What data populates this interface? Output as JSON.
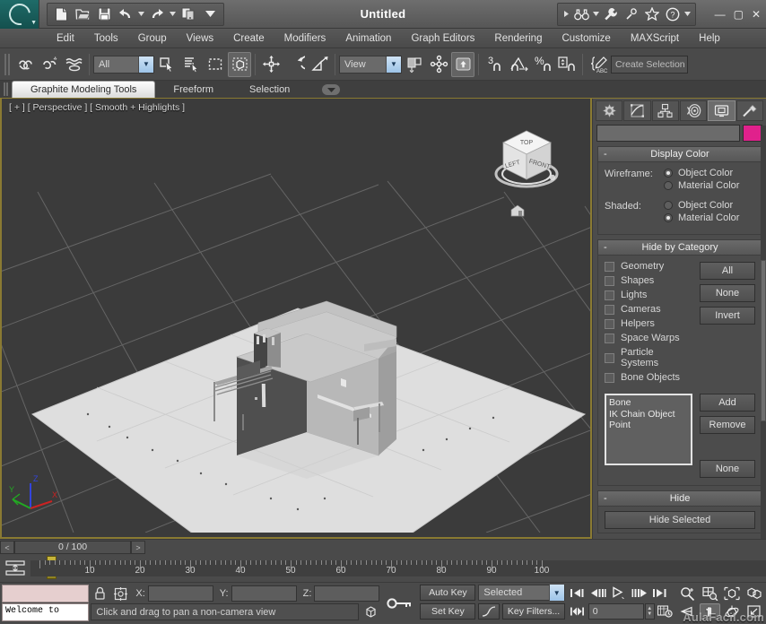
{
  "window": {
    "title": "Untitled",
    "minimize_label": "—",
    "maximize_label": "▢",
    "close_label": "✕"
  },
  "quick_access": [
    {
      "name": "new-file-icon",
      "label": "New"
    },
    {
      "name": "open-file-icon",
      "label": "Open"
    },
    {
      "name": "save-file-icon",
      "label": "Save"
    },
    {
      "name": "undo-icon",
      "label": "Undo"
    },
    {
      "name": "undo-dropdown-icon",
      "label": "Undo list"
    },
    {
      "name": "redo-icon",
      "label": "Redo"
    },
    {
      "name": "redo-dropdown-icon",
      "label": "Redo list"
    },
    {
      "name": "project-folder-icon",
      "label": "Set Project Folder"
    },
    {
      "name": "qat-dropdown-icon",
      "label": "Customize Quick Access Toolbar"
    }
  ],
  "right_quick_access": [
    {
      "name": "qat-expand-icon",
      "label": "Expand"
    },
    {
      "name": "search-binoculars-icon",
      "label": "Search"
    },
    {
      "name": "search-dropdown-icon",
      "label": "Search options"
    },
    {
      "name": "wrench-icon",
      "label": "Tools"
    },
    {
      "name": "autodesk-tool-icon",
      "label": "Autodesk Account"
    },
    {
      "name": "star-favorites-icon",
      "label": "Favorites"
    },
    {
      "name": "help-icon",
      "label": "Help"
    },
    {
      "name": "help-dropdown-icon",
      "label": "Help options"
    }
  ],
  "menu": [
    "Edit",
    "Tools",
    "Group",
    "Views",
    "Create",
    "Modifiers",
    "Animation",
    "Graph Editors",
    "Rendering",
    "Customize",
    "MAXScript",
    "Help"
  ],
  "toolbar": {
    "selection_filter": "All",
    "reference_coord": "View",
    "selection_set_placeholder": "Create Selection S",
    "buttons": [
      {
        "name": "select-and-link-icon",
        "label": "Select and Link"
      },
      {
        "name": "unlink-selection-icon",
        "label": "Unlink Selection"
      },
      {
        "name": "bind-space-warp-icon",
        "label": "Bind to Space Warp"
      },
      {
        "name": "select-object-icon",
        "label": "Select Object"
      },
      {
        "name": "select-by-name-icon",
        "label": "Select by Name"
      },
      {
        "name": "rectangular-region-icon",
        "label": "Rectangular Selection Region"
      },
      {
        "name": "window-crossing-icon",
        "label": "Window/Crossing"
      },
      {
        "name": "select-and-move-icon",
        "label": "Select and Move"
      },
      {
        "name": "select-and-rotate-icon",
        "label": "Select and Rotate"
      },
      {
        "name": "select-and-scale-icon",
        "label": "Select and Uniform Scale"
      },
      {
        "name": "use-center-icon",
        "label": "Use Pivot Point Center"
      },
      {
        "name": "select-and-manipulate-icon",
        "label": "Select and Manipulate"
      },
      {
        "name": "snaps-toggle-icon",
        "label": "3D Snaps Toggle"
      },
      {
        "name": "angle-snap-icon",
        "label": "Angle Snap Toggle"
      },
      {
        "name": "percent-snap-icon",
        "label": "Percent Snap Toggle"
      },
      {
        "name": "spinner-snap-icon",
        "label": "Spinner Snap Toggle"
      },
      {
        "name": "named-selection-sets-icon",
        "label": "Edit Named Selection Sets"
      }
    ]
  },
  "ribbon": {
    "tabs": [
      {
        "label": "Graphite Modeling Tools",
        "active": true
      },
      {
        "label": "Freeform",
        "active": false
      },
      {
        "label": "Selection",
        "active": false
      }
    ],
    "dropdown_label": "▾"
  },
  "viewport": {
    "label": "[ + ] [ Perspective ] [ Smooth + Highlights ]",
    "background": "#3b3b3b",
    "grid_color": "#6e6e6e",
    "ground_color": "#dcdcdc",
    "viewcube": {
      "top_label": "TOP",
      "left_label": "LEFT",
      "front_label": "FRONT"
    },
    "axis": {
      "x_label": "X",
      "y_label": "Y",
      "z_label": "Z",
      "x_color": "#cc2222",
      "y_color": "#22aa22",
      "z_color": "#3344dd"
    }
  },
  "command_panel": {
    "tabs": [
      {
        "name": "create-tab",
        "label": "Create",
        "active": false
      },
      {
        "name": "modify-tab",
        "label": "Modify",
        "active": false
      },
      {
        "name": "hierarchy-tab",
        "label": "Hierarchy",
        "active": false
      },
      {
        "name": "motion-tab",
        "label": "Motion",
        "active": false
      },
      {
        "name": "display-tab",
        "label": "Display",
        "active": true
      },
      {
        "name": "utilities-tab",
        "label": "Utilities",
        "active": false
      }
    ],
    "object_name": "",
    "object_color": "#e0218c",
    "display_color": {
      "title": "Display Color",
      "collapse": "-",
      "wireframe_label": "Wireframe:",
      "shaded_label": "Shaded:",
      "wireframe_options": [
        {
          "label": "Object Color",
          "selected": true
        },
        {
          "label": "Material Color",
          "selected": false
        }
      ],
      "shaded_options": [
        {
          "label": "Object Color",
          "selected": false
        },
        {
          "label": "Material Color",
          "selected": true
        }
      ]
    },
    "hide_by_category": {
      "title": "Hide by Category",
      "collapse": "-",
      "categories": [
        {
          "label": "Geometry",
          "checked": false
        },
        {
          "label": "Shapes",
          "checked": false
        },
        {
          "label": "Lights",
          "checked": false
        },
        {
          "label": "Cameras",
          "checked": false
        },
        {
          "label": "Helpers",
          "checked": false
        },
        {
          "label": "Space Warps",
          "checked": false
        },
        {
          "label": "Particle Systems",
          "checked": false
        },
        {
          "label": "Bone Objects",
          "checked": false
        }
      ],
      "buttons": [
        "All",
        "None",
        "Invert"
      ],
      "list_items": [
        "Bone",
        "IK Chain Object",
        "Point"
      ],
      "list_buttons": [
        "Add",
        "Remove",
        "None"
      ]
    },
    "hide": {
      "title": "Hide",
      "collapse": "-",
      "hide_selected_label": "Hide Selected"
    }
  },
  "timeline": {
    "prev_arrow": "<",
    "next_arrow": ">",
    "frame_display": "0 / 100",
    "ruler_ticks": [
      10,
      20,
      30,
      40,
      50,
      60,
      70,
      80,
      90,
      100
    ],
    "slider_label": "0",
    "range_start": 0,
    "range_end": 100
  },
  "status": {
    "listener_output": "Welcome to",
    "x_label": "X:",
    "y_label": "Y:",
    "z_label": "Z:",
    "x_value": "",
    "y_value": "",
    "z_value": "",
    "prompt": "Click and drag to pan a non-camera view",
    "lock_icon_name": "selection-lock-icon",
    "absolute_mode_icon_name": "absolute-relative-toggle-icon"
  },
  "animation": {
    "auto_key_label": "Auto Key",
    "set_key_label": "Set Key",
    "filter_value": "Selected",
    "key_filters_label": "Key Filters...",
    "current_frame": "0",
    "key_mode_icon": "key-mode-toggle-icon",
    "transport": [
      {
        "name": "go-to-start-icon",
        "label": "Go to Start"
      },
      {
        "name": "previous-frame-icon",
        "label": "Previous Frame"
      },
      {
        "name": "play-animation-icon",
        "label": "Play Animation"
      },
      {
        "name": "next-frame-icon",
        "label": "Next Frame"
      },
      {
        "name": "go-to-end-icon",
        "label": "Go to End"
      }
    ]
  },
  "viewport_nav": [
    {
      "name": "zoom-icon",
      "label": "Zoom",
      "active": false
    },
    {
      "name": "zoom-all-icon",
      "label": "Zoom All",
      "active": false
    },
    {
      "name": "zoom-extents-icon",
      "label": "Zoom Extents",
      "active": false
    },
    {
      "name": "zoom-extents-all-icon",
      "label": "Zoom Extents All",
      "active": false
    },
    {
      "name": "field-of-view-icon",
      "label": "Field-of-View",
      "active": false
    },
    {
      "name": "pan-view-icon",
      "label": "Pan View",
      "active": true
    },
    {
      "name": "orbit-icon",
      "label": "Orbit",
      "active": false
    },
    {
      "name": "maximize-viewport-icon",
      "label": "Maximize Viewport Toggle",
      "active": false
    }
  ],
  "watermark": "AulaFacil.com"
}
